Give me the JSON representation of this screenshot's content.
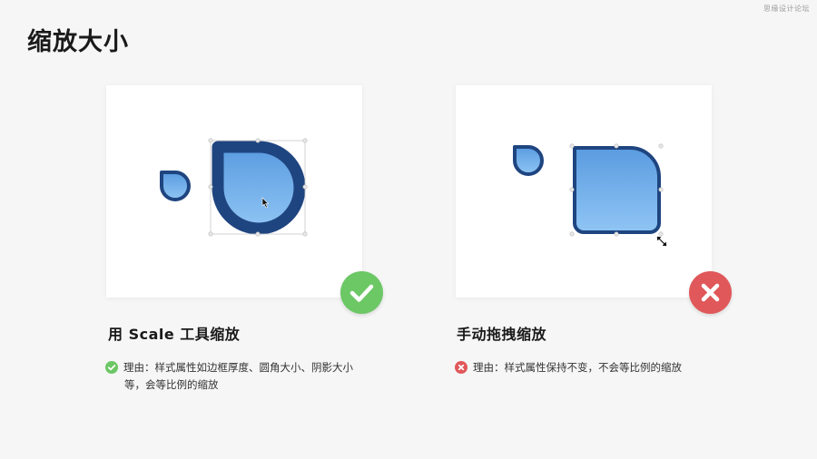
{
  "page": {
    "title": "缩放大小",
    "watermark": "思缘设计论坛"
  },
  "left": {
    "heading": "用 Scale 工具缩放",
    "reason_line1": "理由：样式属性如边框厚度、圆角大小、阴影大小",
    "reason_line2": "等，会等比例的缩放",
    "badge_icon": "check-icon",
    "status_color": "#6cc765"
  },
  "right": {
    "heading": "手动拖拽缩放",
    "reason_line1": "理由：样式属性保持不变，不会等比例的缩放",
    "badge_icon": "cross-icon",
    "status_color": "#e0585a"
  },
  "colors": {
    "shape_border": "#1f4580",
    "shape_fill_top": "#5a9be0",
    "shape_fill_bottom": "#8fc5f4"
  }
}
